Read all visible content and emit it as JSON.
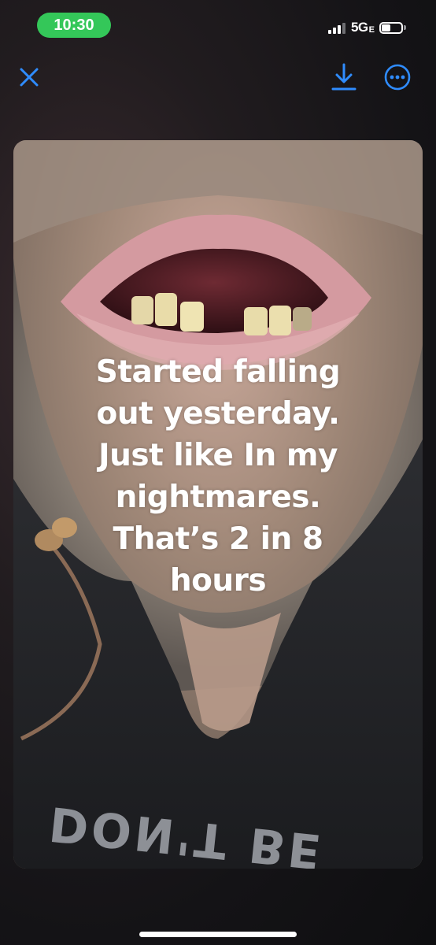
{
  "status_bar": {
    "time": "10:30",
    "network": "5G",
    "network_suffix": "E",
    "signal_bars": 3,
    "signal_bars_total": 4,
    "battery_level": 0.45
  },
  "nav": {
    "close_icon": "close-icon",
    "download_icon": "download-icon",
    "more_icon": "more-options-icon",
    "accent_color": "#2f8cff"
  },
  "story": {
    "caption_lines": [
      "Started falling",
      "out yesterday.",
      "Just like In my",
      "nightmares.",
      "That’s 2 in 8",
      "hours"
    ],
    "shirt_text": "DON'T BE"
  },
  "colors": {
    "time_pill": "#34c759",
    "caption_text": "#ffffff"
  }
}
